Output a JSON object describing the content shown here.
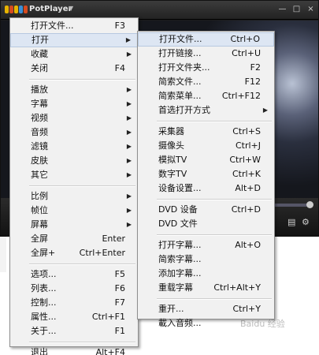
{
  "window": {
    "title": "PotPlayer",
    "controls": [
      "—",
      "□",
      "×"
    ]
  },
  "main_menu": {
    "groups": [
      [
        {
          "label": "打开文件...",
          "shortcut": "F3",
          "submenu": false
        },
        {
          "label": "打开",
          "shortcut": "",
          "submenu": true,
          "active": true
        },
        {
          "label": "收藏",
          "shortcut": "",
          "submenu": true
        },
        {
          "label": "关闭",
          "shortcut": "F4",
          "submenu": false
        }
      ],
      [
        {
          "label": "播放",
          "shortcut": "",
          "submenu": true
        },
        {
          "label": "字幕",
          "shortcut": "",
          "submenu": true
        },
        {
          "label": "视频",
          "shortcut": "",
          "submenu": true
        },
        {
          "label": "音频",
          "shortcut": "",
          "submenu": true
        },
        {
          "label": "滤镜",
          "shortcut": "",
          "submenu": true
        },
        {
          "label": "皮肤",
          "shortcut": "",
          "submenu": true
        },
        {
          "label": "其它",
          "shortcut": "",
          "submenu": true
        }
      ],
      [
        {
          "label": "比例",
          "shortcut": "",
          "submenu": true
        },
        {
          "label": "帧位",
          "shortcut": "",
          "submenu": true
        },
        {
          "label": "屏幕",
          "shortcut": "",
          "submenu": true
        },
        {
          "label": "全屏",
          "shortcut": "Enter",
          "submenu": false
        },
        {
          "label": "全屏+",
          "shortcut": "Ctrl+Enter",
          "submenu": false
        }
      ],
      [
        {
          "label": "选项...",
          "shortcut": "F5",
          "submenu": false
        },
        {
          "label": "列表...",
          "shortcut": "F6",
          "submenu": false
        },
        {
          "label": "控制...",
          "shortcut": "F7",
          "submenu": false
        },
        {
          "label": "属性...",
          "shortcut": "Ctrl+F1",
          "submenu": false
        },
        {
          "label": "关于...",
          "shortcut": "F1",
          "submenu": false
        }
      ],
      [
        {
          "label": "退出",
          "shortcut": "Alt+F4",
          "submenu": false
        }
      ]
    ]
  },
  "open_submenu": {
    "groups": [
      [
        {
          "label": "打开文件...",
          "shortcut": "Ctrl+O",
          "submenu": false,
          "active": true
        },
        {
          "label": "打开链接...",
          "shortcut": "Ctrl+U",
          "submenu": false
        },
        {
          "label": "打开文件夹...",
          "shortcut": "F2",
          "submenu": false
        },
        {
          "label": "简索文件...",
          "shortcut": "F12",
          "submenu": false
        },
        {
          "label": "简索菜单...",
          "shortcut": "Ctrl+F12",
          "submenu": false
        },
        {
          "label": "首选打开方式",
          "shortcut": "",
          "submenu": true
        }
      ],
      [
        {
          "label": "采集器",
          "shortcut": "Ctrl+S",
          "submenu": false
        },
        {
          "label": "摄像头",
          "shortcut": "Ctrl+J",
          "submenu": false
        },
        {
          "label": "模拟TV",
          "shortcut": "Ctrl+W",
          "submenu": false
        },
        {
          "label": "数字TV",
          "shortcut": "Ctrl+K",
          "submenu": false
        },
        {
          "label": "设备设置...",
          "shortcut": "Alt+D",
          "submenu": false
        }
      ],
      [
        {
          "label": "DVD 设备",
          "shortcut": "Ctrl+D",
          "submenu": false
        },
        {
          "label": "DVD 文件",
          "shortcut": "",
          "submenu": false
        }
      ],
      [
        {
          "label": "打开字幕...",
          "shortcut": "Alt+O",
          "submenu": false
        },
        {
          "label": "简索字幕...",
          "shortcut": "",
          "submenu": false
        },
        {
          "label": "添加字幕...",
          "shortcut": "",
          "submenu": false
        },
        {
          "label": "重载字幕",
          "shortcut": "Ctrl+Alt+Y",
          "submenu": false
        }
      ],
      [
        {
          "label": "重开...",
          "shortcut": "Ctrl+Y",
          "submenu": false
        },
        {
          "label": "載入音频...",
          "shortcut": "",
          "submenu": false
        }
      ]
    ]
  },
  "colors": {
    "menu_bg": "#f1f1f1",
    "highlight_bg": "#dde6f3",
    "highlight_border": "#b8c9e0",
    "titlebar": "#2a2a2a"
  },
  "watermark": "Baidu 经验"
}
